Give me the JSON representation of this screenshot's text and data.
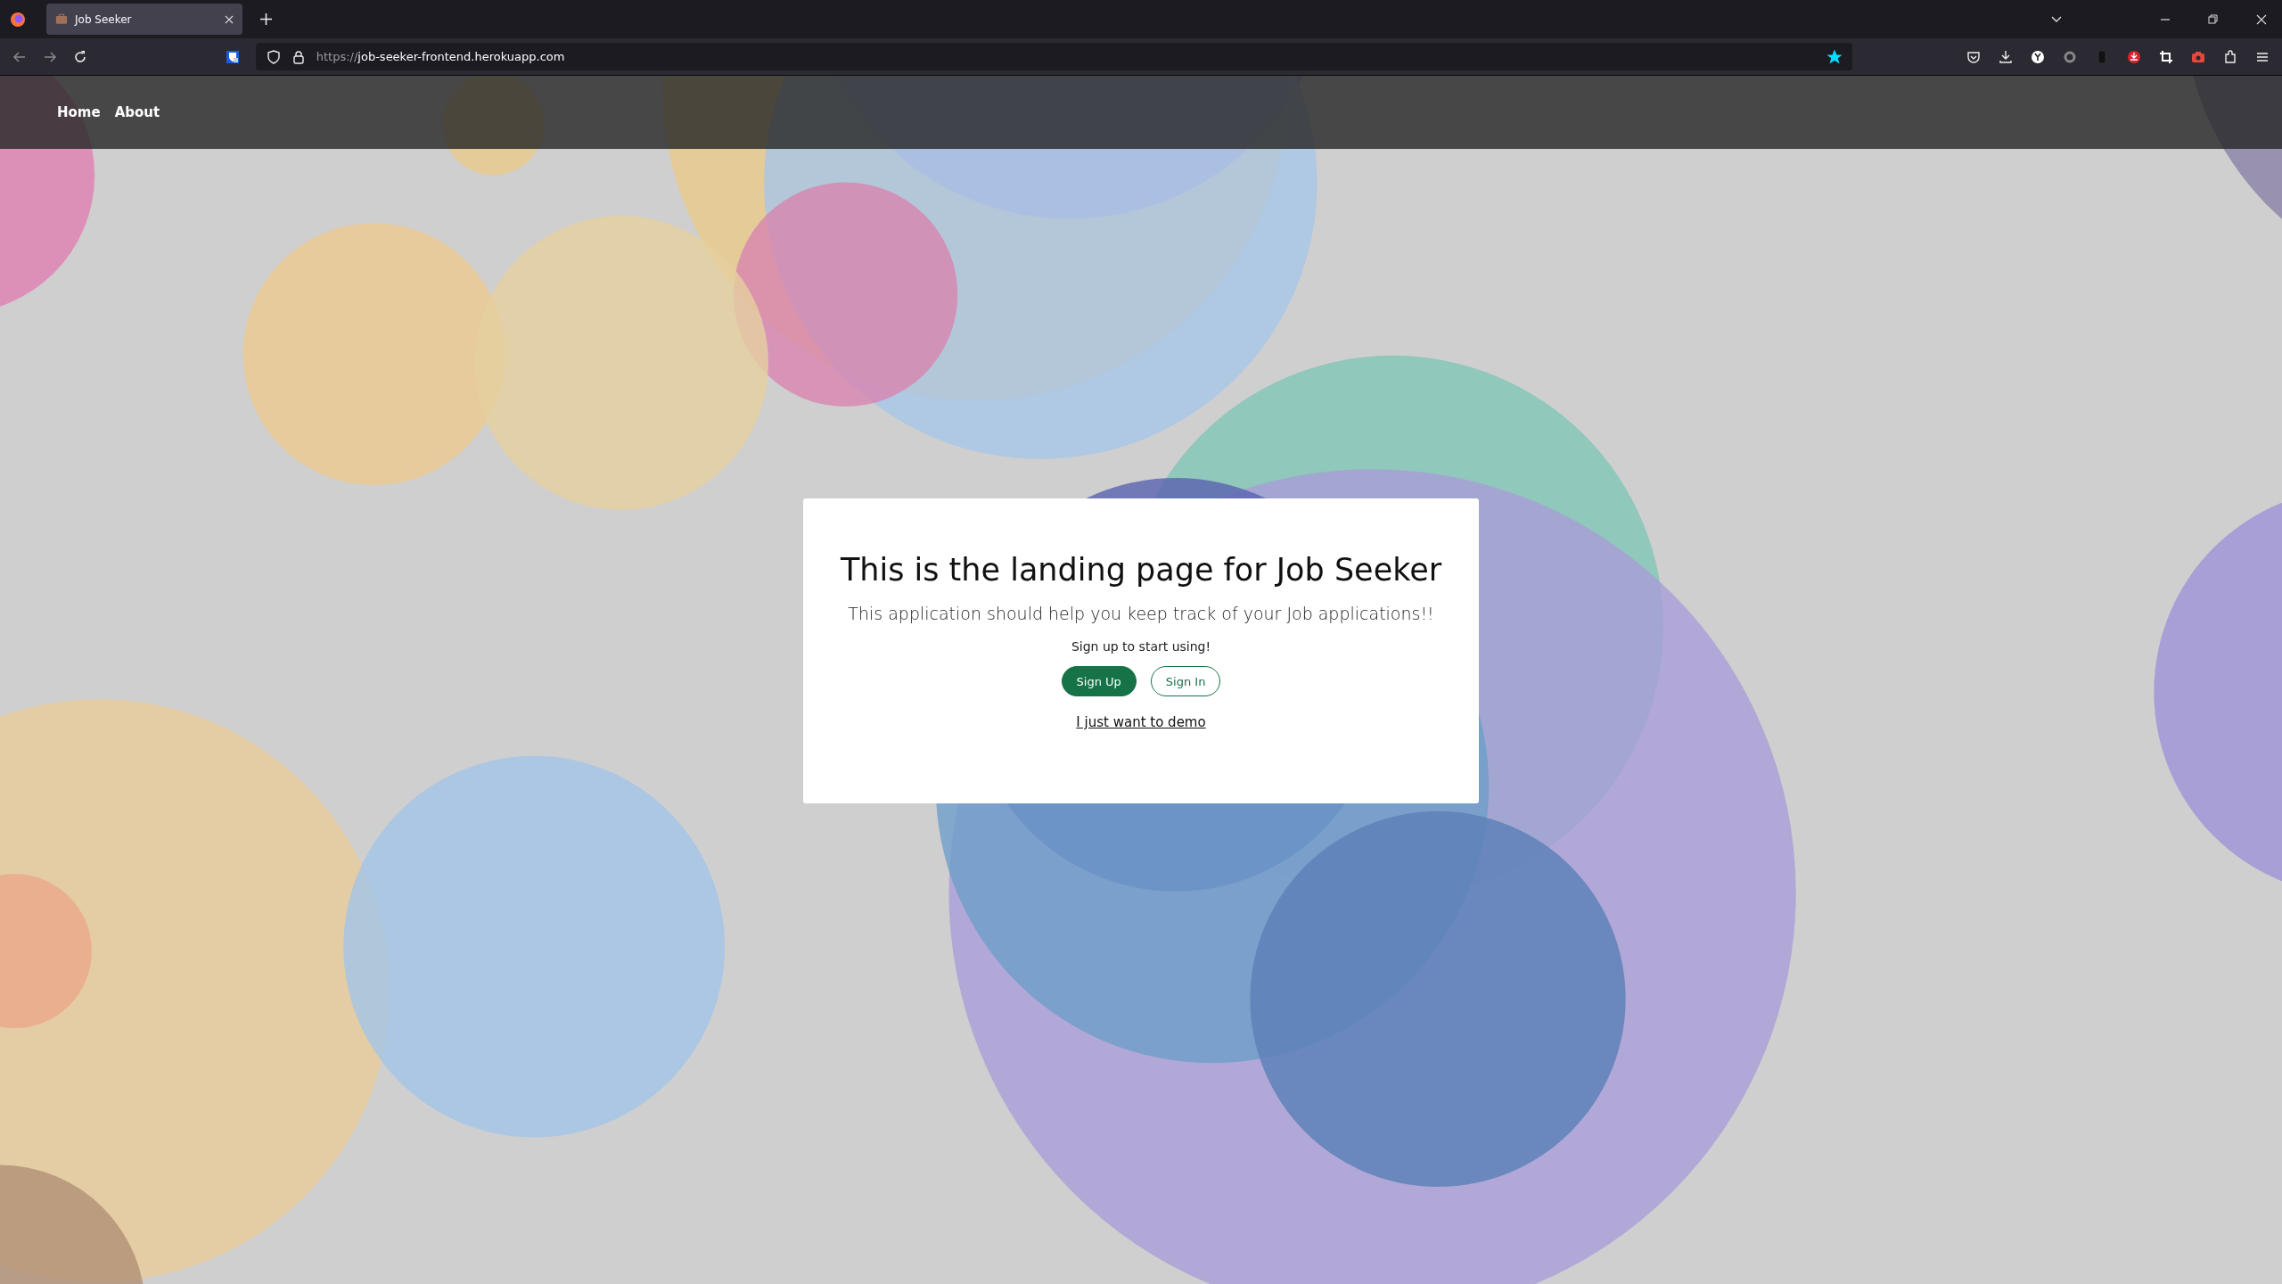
{
  "browser": {
    "tabs": [
      {
        "title": "Job Seeker",
        "selected": true
      }
    ],
    "url_scheme": "https://",
    "url_host": "job-seeker-frontend.herokuapp.com",
    "bookmarked": true
  },
  "nav": {
    "links": [
      "Home",
      "About"
    ]
  },
  "card": {
    "title": "This is the landing page for Job Seeker",
    "lead": "This application should help you keep track of your Job applications!!",
    "prompt": "Sign up to start using!",
    "buttons": [
      {
        "label": "Sign Up",
        "kind": "primary"
      },
      {
        "label": "Sign In",
        "kind": "outline"
      }
    ],
    "demo_link": "I just want to demo"
  }
}
